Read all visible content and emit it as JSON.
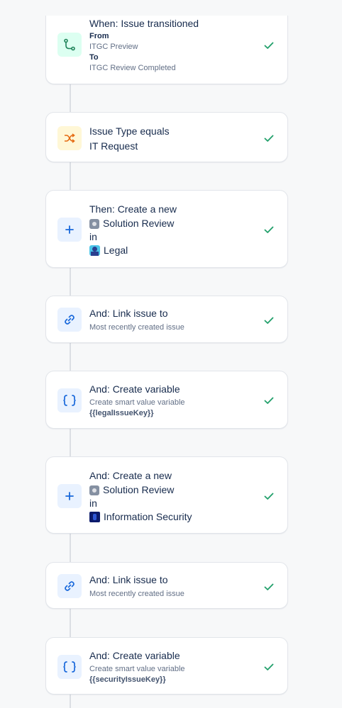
{
  "colors": {
    "accent_blue": "#1868db",
    "check_green": "#22a06b",
    "trigger_green": "#1f845a",
    "condition_orange": "#e56910"
  },
  "cards": [
    {
      "icon": "branch-icon",
      "title": "When: Issue transitioned",
      "from_label": "From",
      "from_value": "ITGC Preview",
      "to_label": "To",
      "to_value": "ITGC Review Completed"
    },
    {
      "icon": "shuffle-icon",
      "line1": "Issue Type equals",
      "line2": "IT Request"
    },
    {
      "icon": "plus-icon",
      "title": "Then: Create a new",
      "issue_type": "Solution Review",
      "in_label": "in",
      "project": "Legal"
    },
    {
      "icon": "link-icon",
      "title": "And: Link issue to",
      "subtitle": "Most recently created issue"
    },
    {
      "icon": "braces-icon",
      "title": "And: Create variable",
      "subtitle": "Create smart value variable",
      "variable": "{{legalIssueKey}}"
    },
    {
      "icon": "plus-icon",
      "title": "And: Create a new",
      "issue_type": "Solution Review",
      "in_label": "in",
      "project": "Information Security"
    },
    {
      "icon": "link-icon",
      "title": "And: Link issue to",
      "subtitle": "Most recently created issue"
    },
    {
      "icon": "braces-icon",
      "title": "And: Create variable",
      "subtitle": "Create smart value variable",
      "variable": "{{securityIssueKey}}"
    }
  ]
}
